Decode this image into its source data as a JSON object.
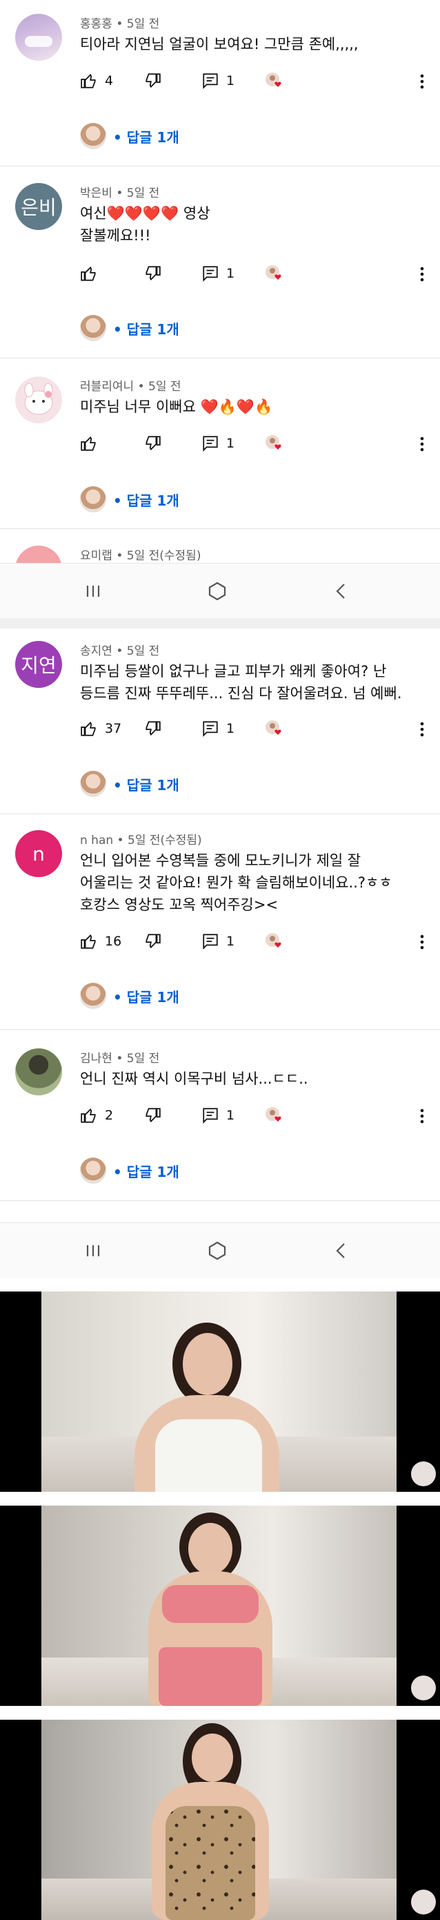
{
  "shot1": {
    "comments": [
      {
        "author": "홍홍홍",
        "time": "5일 전",
        "text": [
          "티아라 지연님 얼굴이 보여요! 그만큼 존예,,,,,"
        ],
        "likes": "4",
        "replies_count": "1",
        "reply_label": "답글 1개",
        "avatar_text": "",
        "avatar_color": "#c9b2d9"
      },
      {
        "author": "박은비",
        "time": "5일 전",
        "text": [
          "여신❤️❤️❤️❤️ 영상",
          "잘볼께요!!!"
        ],
        "likes": "",
        "replies_count": "1",
        "reply_label": "답글 1개",
        "avatar_text": "은비",
        "avatar_color": "#5f7a88"
      },
      {
        "author": "러블리여니",
        "time": "5일 전",
        "text": [
          "미주님 너무 이뻐요 ❤️🔥❤️🔥"
        ],
        "likes": "",
        "replies_count": "1",
        "reply_label": "답글 1개",
        "avatar_text": "",
        "avatar_color": "#f4dce3"
      }
    ],
    "partial": {
      "author": "요미랩",
      "time": "5일 전(수정됨)"
    }
  },
  "shot2": {
    "comments": [
      {
        "author": "송지연",
        "time": "5일 전",
        "text": [
          "미주님 등쌀이 없구나 글고 피부가 왜케 좋아여? 난",
          "등드름 진짜 뚜뚜레뚜... 진심 다 잘어울려요. 넘 예뻐."
        ],
        "likes": "37",
        "replies_count": "1",
        "reply_label": "답글 1개",
        "avatar_text": "지연",
        "avatar_color": "#9c3fb5"
      },
      {
        "author": "n han",
        "time": "5일 전(수정됨)",
        "text": [
          "언니 입어본 수영복들 중에 모노키니가 제일 잘",
          "어울리는 것 같아요! 뭔가 확 슬림해보이네요..?ㅎㅎ",
          "호캉스 영상도 꼬옥 찍어주깅><"
        ],
        "likes": "16",
        "replies_count": "1",
        "reply_label": "답글 1개",
        "avatar_text": "n",
        "avatar_color": "#e0246e"
      },
      {
        "author": "김나현",
        "time": "5일 전",
        "text": [
          "언니 진짜 역시 이목구비 넘사...ㄷㄷ.."
        ],
        "likes": "2",
        "replies_count": "1",
        "reply_label": "답글 1개",
        "avatar_text": "",
        "avatar_color": "#55624a"
      }
    ]
  },
  "nav": {
    "recent": "recent-apps",
    "home": "home",
    "back": "back"
  },
  "photos": [
    {
      "name": "white-swimsuit-photo",
      "suit_color": "#f5f5f2"
    },
    {
      "name": "pink-gingham-bikini-photo",
      "suit_color": "#e8808a"
    },
    {
      "name": "leopard-monokini-photo",
      "suit_color": "#7a5a3c"
    }
  ]
}
